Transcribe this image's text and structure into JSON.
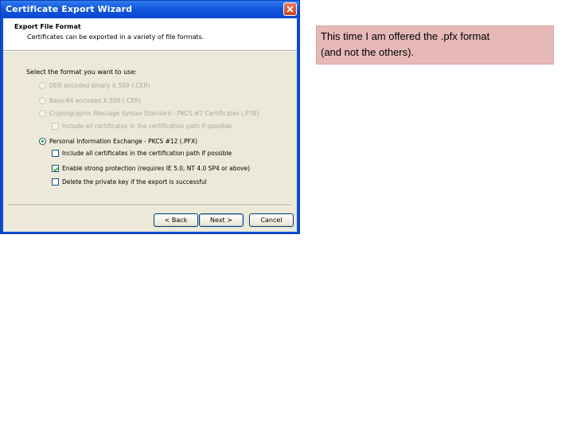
{
  "window": {
    "title": "Certificate Export Wizard"
  },
  "header": {
    "title": "Export File Format",
    "subtitle": "Certificates can be exported in a variety of file formats."
  },
  "form": {
    "select_label": "Select the format you want to use:",
    "options": [
      {
        "label": "DER encoded binary X.509 (.CER)",
        "enabled": false,
        "selected": false
      },
      {
        "label": "Base-64 encoded X.509 (.CER)",
        "enabled": false,
        "selected": false
      },
      {
        "label": "Cryptographic Message Syntax Standard - PKCS #7 Certificates (.P7B)",
        "enabled": false,
        "selected": false
      },
      {
        "label": "Personal Information Exchange - PKCS #12 (.PFX)",
        "enabled": true,
        "selected": true
      }
    ],
    "p7b_include_all": {
      "label": "Include all certificates in the certification path if possible",
      "checked": false,
      "enabled": false
    },
    "pfx_include_all": {
      "label": "Include all certificates in the certification path if possible",
      "checked": false,
      "enabled": true
    },
    "strong_protection": {
      "label": "Enable strong protection (requires IE 5.0, NT 4.0 SP4 or above)",
      "checked": true,
      "enabled": true
    },
    "delete_key": {
      "label": "Delete the private key if the export is successful",
      "checked": false,
      "enabled": true
    }
  },
  "buttons": {
    "back": "< Back",
    "next": "Next >",
    "cancel": "Cancel"
  },
  "note": {
    "line1": "This time I am offered the .pfx format",
    "line2": "(and not the others)."
  }
}
